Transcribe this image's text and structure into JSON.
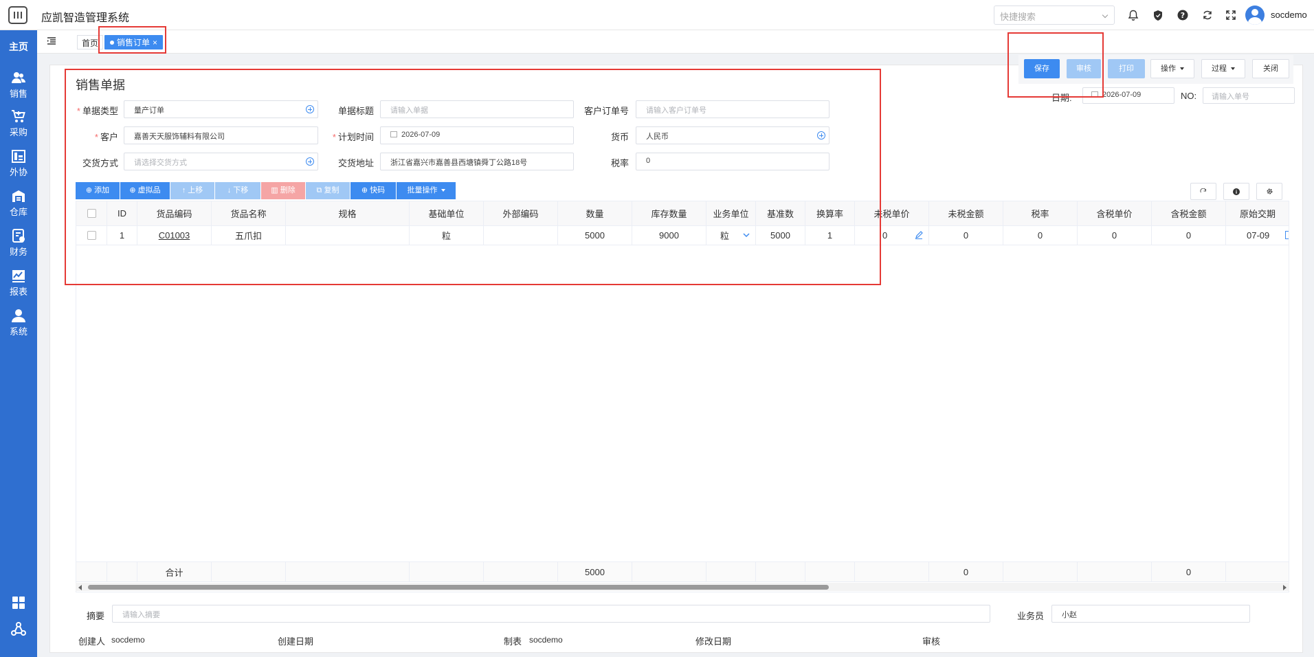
{
  "app": {
    "title": "应凯智造管理系统"
  },
  "header": {
    "quick_search_placeholder": "快捷搜索",
    "username": "socdemo"
  },
  "sidebar": {
    "home": "主页",
    "items": [
      {
        "label": "销售",
        "icon": "users-icon"
      },
      {
        "label": "采购",
        "icon": "cart-icon"
      },
      {
        "label": "外协",
        "icon": "outsource-icon"
      },
      {
        "label": "仓库",
        "icon": "warehouse-icon"
      },
      {
        "label": "财务",
        "icon": "finance-icon"
      },
      {
        "label": "报表",
        "icon": "report-icon"
      },
      {
        "label": "系统",
        "icon": "person-icon"
      }
    ]
  },
  "tabs": {
    "home": "首页",
    "active": "销售订单",
    "close": "×"
  },
  "form": {
    "title": "销售单据",
    "doc_type_label": "单据类型",
    "doc_type_value": "量产订单",
    "doc_title_label": "单据标题",
    "doc_title_placeholder": "请输入单据",
    "cust_order_label": "客户订单号",
    "cust_order_placeholder": "请输入客户订单号",
    "customer_label": "客户",
    "customer_value": "嘉善天天服饰辅料有限公司",
    "plan_time_label": "计划时间",
    "plan_time_value": "2026-07-09",
    "currency_label": "货币",
    "currency_value": "人民币",
    "delivery_method_label": "交货方式",
    "delivery_method_placeholder": "请选择交货方式",
    "delivery_addr_label": "交货地址",
    "delivery_addr_value": "浙江省嘉兴市嘉善县西塘镇舜丁公路18号",
    "tax_rate_label": "税率",
    "tax_rate_value": "0"
  },
  "actions": {
    "save": "保存",
    "audit": "审核",
    "print": "打印",
    "operate": "操作",
    "process": "过程",
    "close": "关闭",
    "date_label": "日期:",
    "date_value": "2026-07-09",
    "no_label": "NO:",
    "no_placeholder": "请输入单号"
  },
  "toolbar": {
    "add": "添加",
    "virtual": "虚拟品",
    "up": "上移",
    "down": "下移",
    "delete": "删除",
    "copy": "复制",
    "quick": "快码",
    "batch": "批量操作"
  },
  "table": {
    "columns": [
      "ID",
      "货品编码",
      "货品名称",
      "规格",
      "基础单位",
      "外部编码",
      "数量",
      "库存数量",
      "业务单位",
      "基准数",
      "换算率",
      "未税单价",
      "未税金额",
      "税率",
      "含税单价",
      "含税金额",
      "原始交期"
    ],
    "rows": [
      {
        "id": "1",
        "code": "C01003",
        "name": "五爪扣",
        "spec": "",
        "base_unit": "粒",
        "ext_code": "",
        "qty": "5000",
        "stock_qty": "9000",
        "biz_unit": "粒",
        "base_num": "5000",
        "conv_rate": "1",
        "unit_price": "0",
        "amount": "0",
        "tax_rate": "0",
        "tax_price": "0",
        "tax_amount": "0",
        "orig_date": "07-09"
      }
    ],
    "footer": {
      "label": "合计",
      "qty": "5000",
      "amount": "0",
      "tax_amount": "0"
    }
  },
  "bottom": {
    "summary_label": "摘要",
    "summary_placeholder": "请输入摘要",
    "salesman_label": "业务员",
    "salesman_value": "小赵",
    "creator_label": "创建人",
    "creator_value": "socdemo",
    "create_date_label": "创建日期",
    "maker_label": "制表",
    "maker_value": "socdemo",
    "modify_date_label": "修改日期",
    "audit_label": "审核"
  },
  "colors": {
    "primary": "#3d8bf0",
    "sidebar": "#2f6fd0",
    "highlight": "#e53935"
  }
}
